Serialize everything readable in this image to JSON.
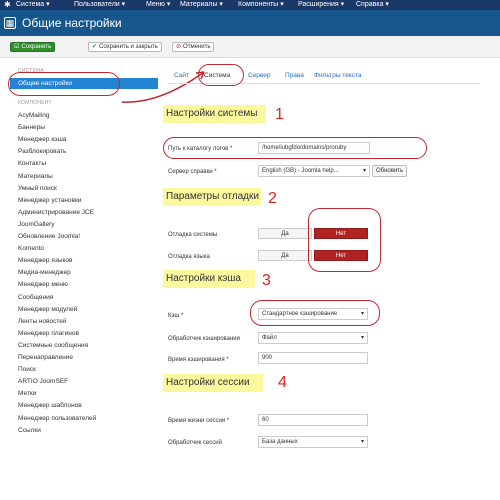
{
  "topnav": {
    "menus": [
      "Система ▾",
      "Пользователи ▾",
      "Меню ▾",
      "Материалы ▾",
      "Компоненты ▾",
      "Расширения ▾",
      "Справка ▾"
    ]
  },
  "title": "Общие настройки",
  "toolbar": {
    "save": "Сохранить",
    "save_close": "Сохранить и закрыть",
    "cancel": "Отменить"
  },
  "sidebar": {
    "system_header": "СИСТЕМА",
    "active": "Общие настройки",
    "component_header": "КОМПОНЕНТ",
    "items": [
      "AcyMailing",
      "Баннеры",
      "Менеджер кэша",
      "Разблокировать",
      "Контакты",
      "Материалы",
      "Умный поиск",
      "Менеджер установки",
      "Администрирование JCE",
      "JoomGallery",
      "Обновление Joomla!",
      "Komento",
      "Менеджер языков",
      "Медиа-менеджер",
      "Менеджер меню",
      "Сообщения",
      "Менеджер модулей",
      "Ленты новостей",
      "Менеджер плагинов",
      "Системные сообщения",
      "Перенаправление",
      "Поиск",
      "ARTIO JoomSEF",
      "Метки",
      "Менеджер шаблонов",
      "Менеджер пользователей",
      "Ссылки"
    ]
  },
  "tabs": [
    "Сайт",
    "Система",
    "Сервер",
    "Права",
    "Фильтры текста"
  ],
  "sections": {
    "system": {
      "title": "Настройки системы",
      "number": "1",
      "log_label": "Путь к каталогу логов *",
      "log_value": "/home/iubgfdo/domains/proruby",
      "help_label": "Сервер справки *",
      "help_value": "English (GB) - Joomla help...",
      "refresh": "Обновить"
    },
    "debug": {
      "title": "Параметры отладки",
      "number": "2",
      "sys_label": "Отладка системы",
      "lang_label": "Отладка языка",
      "yes": "Да",
      "no": "Нет"
    },
    "cache": {
      "title": "Настройки кэша",
      "number": "3",
      "cache_label": "Кэш *",
      "cache_value": "Стандартное кэширование",
      "handler_label": "Обработчик кэширования",
      "handler_value": "Файл",
      "time_label": "Время кэширования *",
      "time_value": "900"
    },
    "session": {
      "title": "Настройки сессии",
      "number": "4",
      "life_label": "Время жизни сессии *",
      "life_value": "60",
      "handler_label": "Обработчик сессий",
      "handler_value": "База данных"
    }
  }
}
